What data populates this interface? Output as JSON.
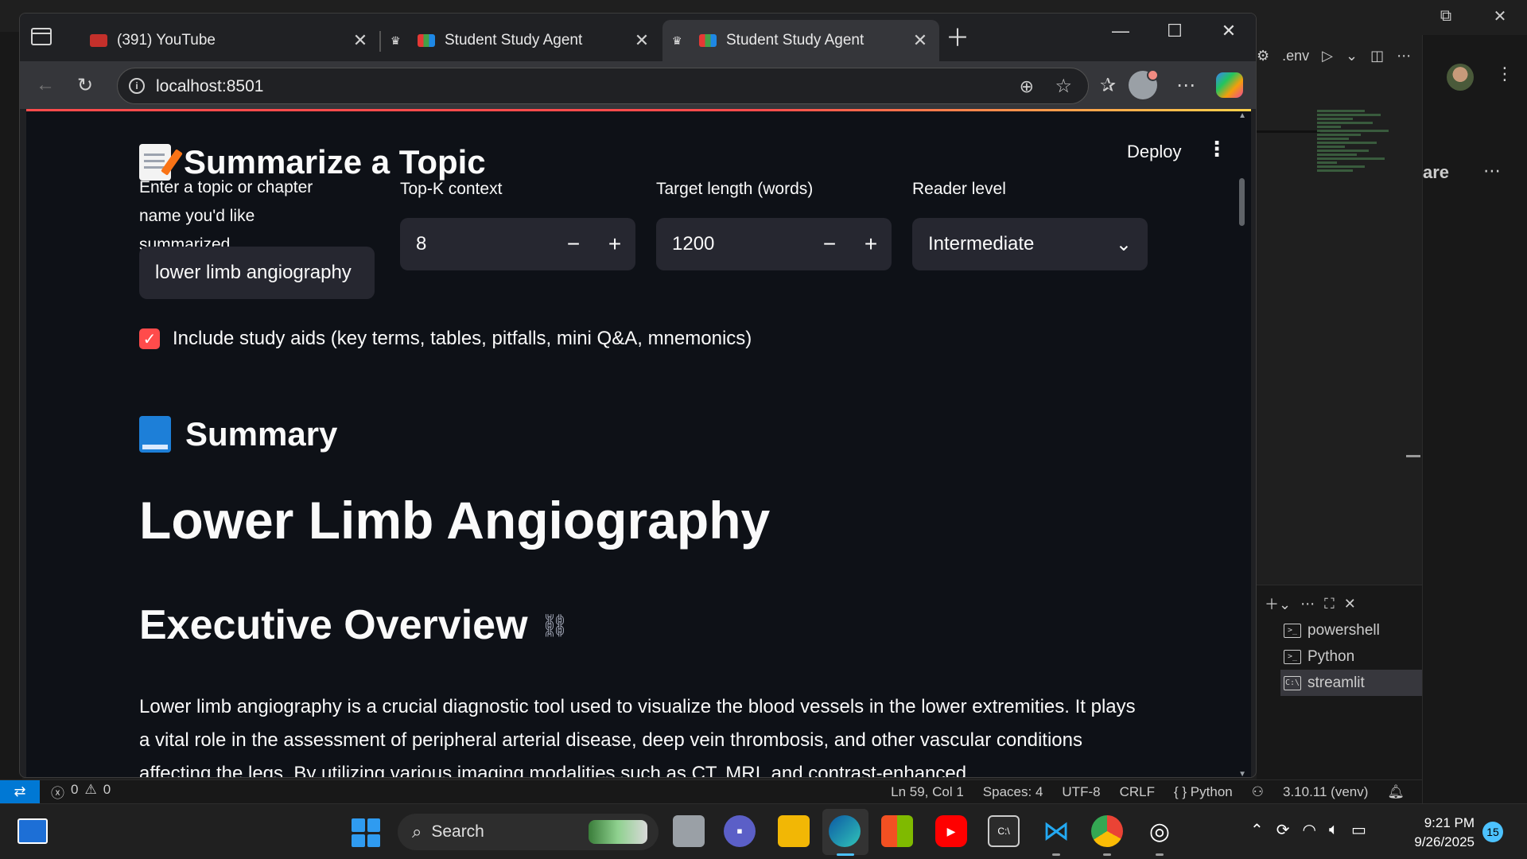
{
  "browser": {
    "tabs": [
      {
        "label": "(391) YouTube"
      },
      {
        "label": "Student Study Agent"
      },
      {
        "label": "Student Study Agent"
      }
    ],
    "url": "localhost:8501"
  },
  "streamlit": {
    "deploy_label": "Deploy",
    "page_heading": "Summarize a Topic",
    "fields": {
      "topic_label": "Enter a topic or chapter name you'd like summarized",
      "topic_value": "lower limb angiography",
      "topk_label": "Top-K context",
      "topk_value": "8",
      "length_label": "Target length (words)",
      "length_value": "1200",
      "level_label": "Reader level",
      "level_value": "Intermediate"
    },
    "study_aids_label": "Include study aids (key terms, tables, pitfalls, mini Q&A, mnemonics)",
    "summary_heading": "Summary",
    "doc_title": "Lower Limb Angiography",
    "section_heading": "Executive Overview",
    "paragraph": "Lower limb angiography is a crucial diagnostic tool used to visualize the blood vessels in the lower extremities. It plays a vital role in the assessment of peripheral arterial disease, deep vein thrombosis, and other vascular conditions affecting the legs. By utilizing various imaging modalities such as CT, MRI, and contrast-enhanced"
  },
  "vscode": {
    "env_label": ".env",
    "secondary_title_fragment": "are",
    "terminals": [
      "powershell",
      "Python",
      "streamlit"
    ],
    "status": {
      "problems": "0",
      "warnings": "0",
      "position": "Ln 59, Col 1",
      "spaces": "Spaces: 4",
      "encoding": "UTF-8",
      "eol": "CRLF",
      "language": "Python",
      "interpreter": "3.10.11 (venv)"
    }
  },
  "taskbar": {
    "search_label": "Search",
    "time": "9:21 PM",
    "date": "9/26/2025",
    "notification_count": "15"
  },
  "colors": {
    "accent": "#ff4b4b",
    "streamlit_bg": "#0e1117",
    "input_bg": "#262730",
    "vscode_status_remote": "#0078d4"
  }
}
